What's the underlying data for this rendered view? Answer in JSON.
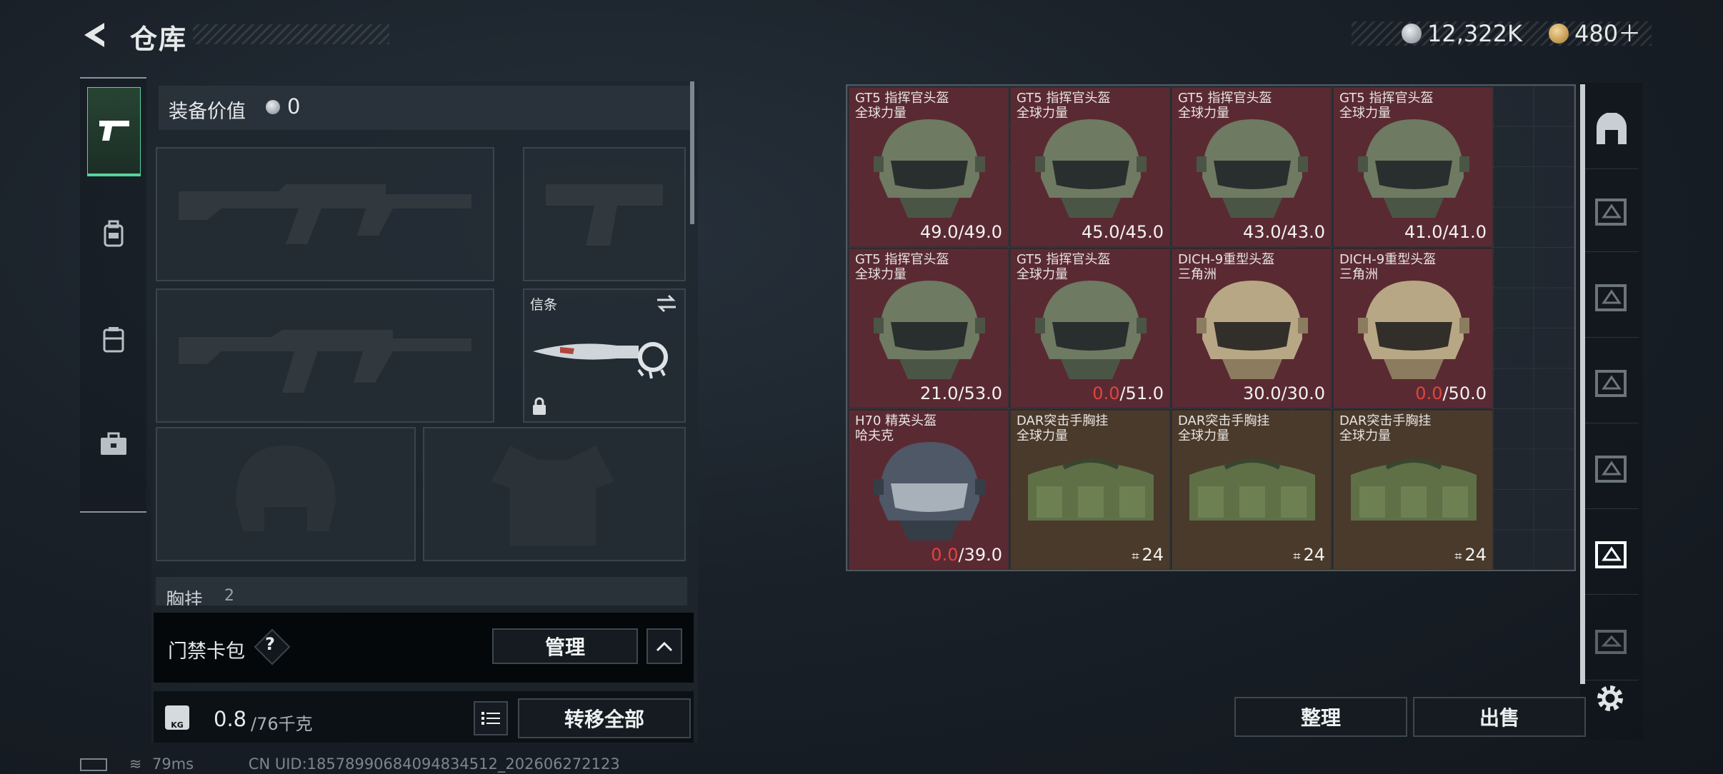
{
  "header": {
    "title": "仓库",
    "currency_silver": "12,322K",
    "currency_gold": "480＋"
  },
  "loadout": {
    "equipment_value_label": "装备价值",
    "equipment_value": "0",
    "melee_label": "信条",
    "chest_rig_label": "胸挂",
    "chest_rig_count": "2",
    "keycard_label": "门禁卡包",
    "help_mark": "?",
    "manage_button": "管理",
    "weight_value": "0.8",
    "weight_max": "/76千克",
    "weight_badge": "KG",
    "transfer_all_button": "转移全部"
  },
  "inventory": {
    "items": [
      {
        "name": "GT5 指挥官头盔",
        "sub": "全球力量",
        "cur": "49.0",
        "max": "/49.0",
        "kind": "helmet-green",
        "bg": "red"
      },
      {
        "name": "GT5 指挥官头盔",
        "sub": "全球力量",
        "cur": "45.0",
        "max": "/45.0",
        "kind": "helmet-green",
        "bg": "red"
      },
      {
        "name": "GT5 指挥官头盔",
        "sub": "全球力量",
        "cur": "43.0",
        "max": "/43.0",
        "kind": "helmet-green",
        "bg": "red"
      },
      {
        "name": "GT5 指挥官头盔",
        "sub": "全球力量",
        "cur": "41.0",
        "max": "/41.0",
        "kind": "helmet-green",
        "bg": "red"
      },
      {
        "name": "GT5 指挥官头盔",
        "sub": "全球力量",
        "cur": "21.0",
        "max": "/53.0",
        "kind": "helmet-green",
        "bg": "red"
      },
      {
        "name": "GT5 指挥官头盔",
        "sub": "全球力量",
        "cur": "0.0",
        "max": "/51.0",
        "kind": "helmet-green",
        "bg": "red",
        "broken": true
      },
      {
        "name": "DICH-9重型头盔",
        "sub": "三角洲",
        "cur": "30.0",
        "max": "/30.0",
        "kind": "helmet-tan",
        "bg": "red"
      },
      {
        "name": "DICH-9重型头盔",
        "sub": "三角洲",
        "cur": "0.0",
        "max": "/50.0",
        "kind": "helmet-tan",
        "bg": "red",
        "broken": true
      },
      {
        "name": "H70 精英头盔",
        "sub": "哈夫克",
        "cur": "0.0",
        "max": "/39.0",
        "kind": "helmet-grey",
        "bg": "red",
        "broken": true
      },
      {
        "name": "DAR突击手胸挂",
        "sub": "全球力量",
        "count": "24",
        "kind": "rig",
        "bg": "brown"
      },
      {
        "name": "DAR突击手胸挂",
        "sub": "全球力量",
        "count": "24",
        "kind": "rig",
        "bg": "brown"
      },
      {
        "name": "DAR突击手胸挂",
        "sub": "全球力量",
        "count": "24",
        "kind": "rig",
        "bg": "brown"
      }
    ]
  },
  "actions": {
    "sort_button": "整理",
    "sell_button": "出售"
  },
  "status": {
    "ping": "79ms",
    "uid": "CN UID:18578990684094834512_202606272123"
  },
  "colors": {
    "accent_green": "#55d49a",
    "broken_red": "#e2433f",
    "cell_red": "#5a2a33",
    "cell_brown": "#4a3a2b"
  }
}
